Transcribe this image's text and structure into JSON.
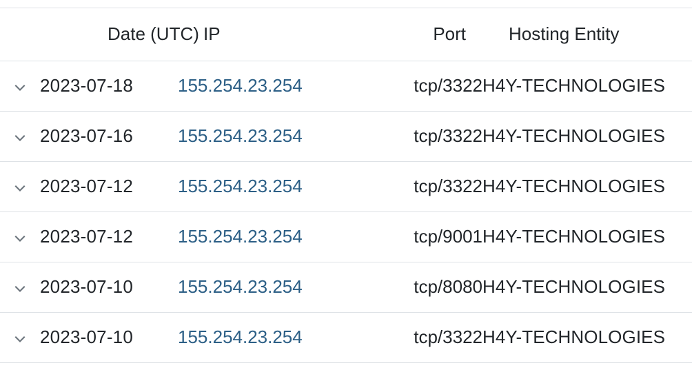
{
  "table": {
    "columns": [
      {
        "key": "toggle",
        "label": "",
        "align": "center"
      },
      {
        "key": "date",
        "label": "Date (UTC)",
        "align": "left"
      },
      {
        "key": "ip",
        "label": "IP",
        "align": "left"
      },
      {
        "key": "port",
        "label": "Port",
        "align": "right"
      },
      {
        "key": "entity",
        "label": "Hosting Entity",
        "align": "left"
      }
    ],
    "toggle_icon": "chevron-down-icon",
    "rows": [
      {
        "date": "2023-07-18",
        "ip": "155.254.23.254",
        "port": "tcp/3322",
        "entity": "H4Y-TECHNOLOGIES"
      },
      {
        "date": "2023-07-16",
        "ip": "155.254.23.254",
        "port": "tcp/3322",
        "entity": "H4Y-TECHNOLOGIES"
      },
      {
        "date": "2023-07-12",
        "ip": "155.254.23.254",
        "port": "tcp/3322",
        "entity": "H4Y-TECHNOLOGIES"
      },
      {
        "date": "2023-07-12",
        "ip": "155.254.23.254",
        "port": "tcp/9001",
        "entity": "H4Y-TECHNOLOGIES"
      },
      {
        "date": "2023-07-10",
        "ip": "155.254.23.254",
        "port": "tcp/8080",
        "entity": "H4Y-TECHNOLOGIES"
      },
      {
        "date": "2023-07-10",
        "ip": "155.254.23.254",
        "port": "tcp/3322",
        "entity": "H4Y-TECHNOLOGIES"
      }
    ]
  },
  "colors": {
    "text": "#212529",
    "link": "#2c5f86",
    "rule": "#dee2e6",
    "icon": "#6c757d",
    "background": "#ffffff"
  }
}
